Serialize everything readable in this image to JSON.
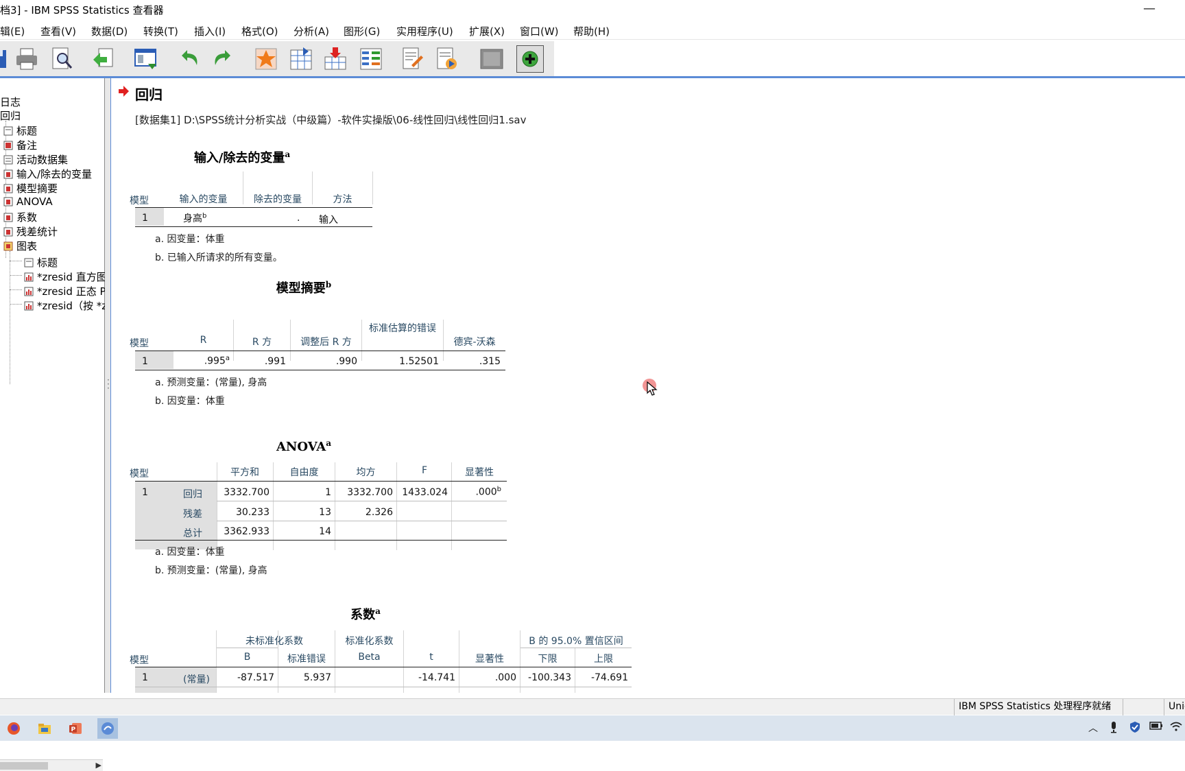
{
  "window": {
    "title": "档3] - IBM SPSS Statistics 查看器",
    "minimize": "—"
  },
  "menu": [
    "辑(E)",
    "查看(V)",
    "数据(D)",
    "转换(T)",
    "插入(I)",
    "格式(O)",
    "分析(A)",
    "图形(G)",
    "实用程序(U)",
    "扩展(X)",
    "窗口(W)",
    "帮助(H)"
  ],
  "toolbar": {
    "icons": [
      "save-icon",
      "print-icon",
      "print-preview-icon",
      "export-icon",
      "recall-dialog-icon",
      "undo-icon",
      "redo-icon",
      "goto-data-icon",
      "goto-case-icon",
      "goto-variable-icon",
      "variables-icon",
      "show-all-icon",
      "insert-output-icon",
      "insert-chart-icon",
      "designate-window-icon",
      "add-icon"
    ]
  },
  "outline": {
    "items": [
      "日志",
      "回归",
      "标题",
      "备注",
      "活动数据集",
      "输入/除去的变量",
      "模型摘要",
      "ANOVA",
      "系数",
      "残差统计",
      "图表",
      "标题",
      "*zresid 直方图",
      "*zresid 正态 P",
      "*zresid（按 *z"
    ]
  },
  "content": {
    "section_title": "回归",
    "dataset": "[数据集1] D:\\SPSS统计分析实战（中级篇）-软件实操版\\06-线性回归\\线性回归1.sav",
    "table1": {
      "title": "输入/除去的变量",
      "title_sup": "a",
      "headers": [
        "模型",
        "输入的变量",
        "除去的变量",
        "方法"
      ],
      "row": {
        "model": "1",
        "entered": "身高",
        "entered_sup": "b",
        "removed": ".",
        "method": "输入"
      },
      "notes": [
        "a. 因变量：体重",
        "b. 已输入所请求的所有变量。"
      ]
    },
    "table2": {
      "title": "模型摘要",
      "title_sup": "b",
      "headers": [
        "模型",
        "R",
        "R 方",
        "调整后 R 方",
        "标准估算的错误",
        "德宾-沃森"
      ],
      "row": {
        "model": "1",
        "r": ".995",
        "r_sup": "a",
        "r2": ".991",
        "adj_r2": ".990",
        "se": "1.52501",
        "dw": ".315"
      },
      "notes": [
        "a. 预测变量：(常量), 身高",
        "b. 因变量：体重"
      ]
    },
    "table3": {
      "title": "ANOVA",
      "title_sup": "a",
      "headers": [
        "模型",
        "平方和",
        "自由度",
        "均方",
        "F",
        "显著性"
      ],
      "model": "1",
      "rows": [
        {
          "label": "回归",
          "ss": "3332.700",
          "df": "1",
          "ms": "3332.700",
          "f": "1433.024",
          "sig": ".000",
          "sig_sup": "b"
        },
        {
          "label": "残差",
          "ss": "30.233",
          "df": "13",
          "ms": "2.326",
          "f": "",
          "sig": ""
        },
        {
          "label": "总计",
          "ss": "3362.933",
          "df": "14",
          "ms": "",
          "f": "",
          "sig": ""
        }
      ],
      "notes": [
        "a. 因变量：体重",
        "b. 预测变量：(常量), 身高"
      ]
    },
    "table4": {
      "title": "系数",
      "title_sup": "a",
      "group_headers": [
        "未标准化系数",
        "标准化系数",
        "B 的 95.0% 置信区间"
      ],
      "headers": [
        "模型",
        "B",
        "标准错误",
        "Beta",
        "t",
        "显著性",
        "下限",
        "上限"
      ],
      "row": {
        "model": "1",
        "label": "(常量)",
        "b": "-87.517",
        "se": "5.937",
        "beta": "",
        "t": "-14.741",
        "sig": ".000",
        "lower": "-100.343",
        "upper": "-74.691"
      }
    }
  },
  "statusbar": {
    "processor": "IBM SPSS Statistics 处理程序就绪",
    "encoding": "Unic"
  },
  "taskbar": {
    "apps": [
      "firefox-icon",
      "file-explorer-icon",
      "powerpoint-icon",
      "spss-icon"
    ]
  },
  "colors": {
    "accent": "#5b8bd6",
    "arrow": "#e02020",
    "header_text": "#2a4a63",
    "shade": "#e0e0e0"
  }
}
